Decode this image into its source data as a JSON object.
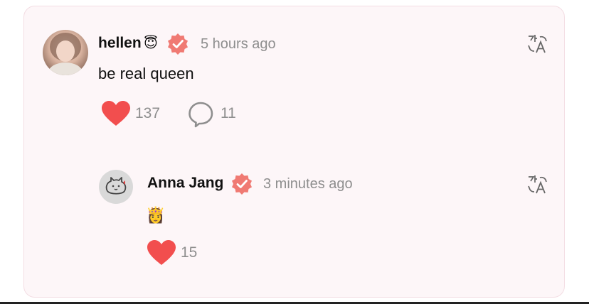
{
  "comment": {
    "username": "hellen",
    "username_emoji": "😇",
    "verified_icon": "verified-badge-icon",
    "timestamp": "5 hours ago",
    "text": "be real queen",
    "likes": "137",
    "replies": "11",
    "translate_icon": "translate-icon"
  },
  "reply": {
    "username": "Anna Jang",
    "verified_icon": "verified-badge-icon",
    "timestamp": "3 minutes ago",
    "text": "👸",
    "likes": "15",
    "translate_icon": "translate-icon"
  },
  "colors": {
    "heart": "#f24e4e",
    "badge": "#f07a73",
    "card_bg": "#fdf6f8",
    "muted_text": "#8e8e8e"
  }
}
